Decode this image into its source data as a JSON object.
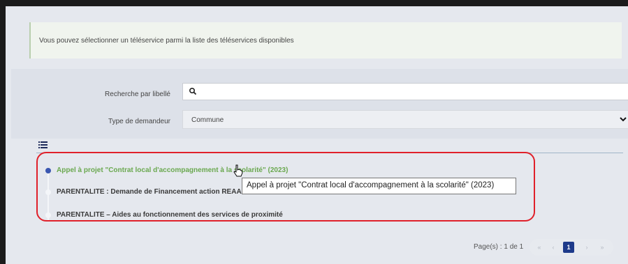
{
  "info": {
    "message": "Vous pouvez sélectionner un téléservice parmi la liste des téléservices disponibles"
  },
  "search": {
    "label": "Recherche par libellé",
    "value": "",
    "placeholder": ""
  },
  "requester": {
    "label": "Type de demandeur",
    "selected": "Commune"
  },
  "list": {
    "items": [
      {
        "label": "Appel à projet \"Contrat local d'accompagnement à la scolarité\" (2023)"
      },
      {
        "label": "PARENTALITE : Demande de Financement action REAAP 2"
      },
      {
        "label": "PARENTALITE – Aides au fonctionnement des services de proximité"
      }
    ]
  },
  "tooltip": {
    "text": "Appel à projet \"Contrat local d'accompagnement à la scolarité\" (2023)"
  },
  "pagination": {
    "label": "Page(s) : 1 de 1",
    "first": "«",
    "prev": "‹",
    "current": "1",
    "next": "›",
    "last": "»"
  },
  "colors": {
    "accent_active": "#6aa84f",
    "highlight": "#e0202a",
    "pager_active": "#1d3a8a"
  },
  "icons": {
    "search": "search-icon",
    "dropdown": "chevron-down-icon",
    "list": "list-icon"
  }
}
